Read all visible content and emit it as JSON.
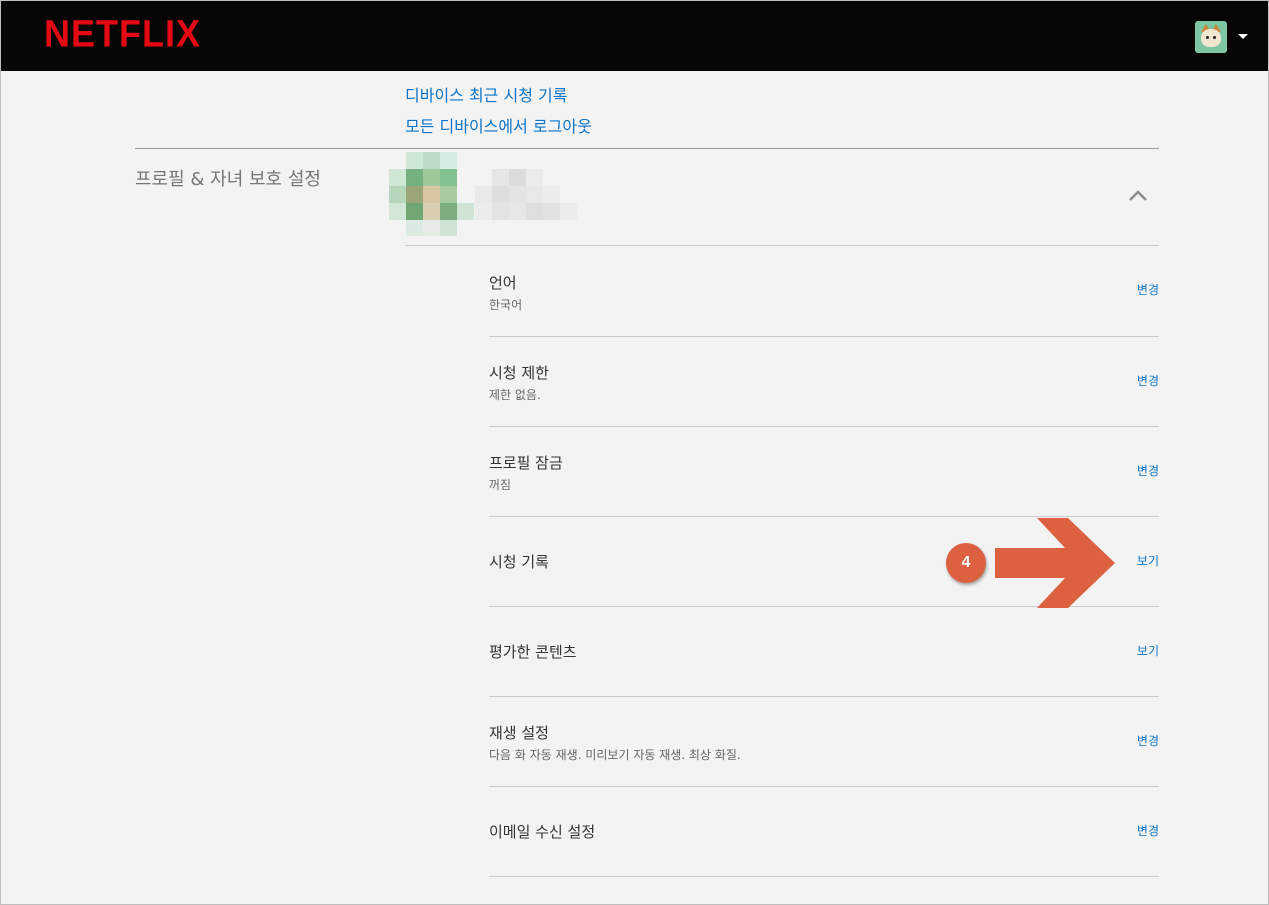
{
  "header": {
    "logo": "NETFLIX",
    "ghost_links": [
      "",
      "",
      ""
    ]
  },
  "device_links": {
    "recent_history": "디바이스 최근 시청 기록",
    "sign_out_all": "모든 디바이스에서 로그아웃"
  },
  "profile_section": {
    "title": "프로필 & 자녀 보호 설정",
    "rows": [
      {
        "title": "언어",
        "subtitle": "한국어",
        "action": "변경"
      },
      {
        "title": "시청 제한",
        "subtitle": "제한 없음.",
        "action": "변경"
      },
      {
        "title": "프로필 잠금",
        "subtitle": "꺼짐",
        "action": "변경"
      },
      {
        "title": "시청 기록",
        "subtitle": "",
        "action": "보기"
      },
      {
        "title": "평가한 콘텐츠",
        "subtitle": "",
        "action": "보기"
      },
      {
        "title": "재생 설정",
        "subtitle": "다음 화 자동 재생. 미리보기 자동 재생. 최상 화질.",
        "action": "변경"
      },
      {
        "title": "이메일 수신 설정",
        "subtitle": "",
        "action": "변경"
      }
    ]
  },
  "annotation": {
    "step": "4",
    "color": "#dc6140"
  },
  "colors": {
    "brand": "#e50914",
    "link": "#0b74c8",
    "header_bg": "#060606",
    "page_bg": "#f3f3f3"
  },
  "icons": {
    "profile_menu": "avatar-icon",
    "dropdown": "caret-down-icon",
    "collapse": "chevron-up-icon"
  }
}
